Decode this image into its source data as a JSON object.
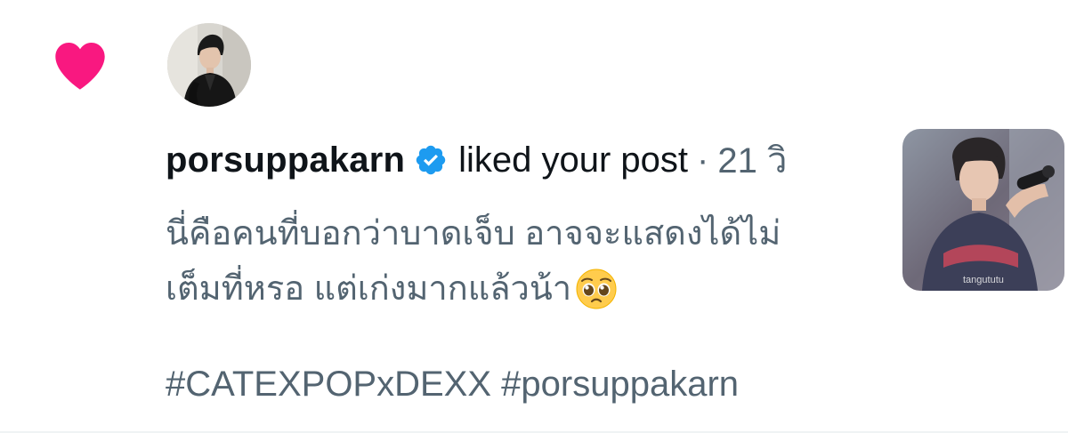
{
  "notification": {
    "type_icon": "heart-icon",
    "avatar": "user-avatar",
    "username": "porsuppakarn",
    "verified_icon": "verified-badge-icon",
    "action": "liked your post",
    "separator": "·",
    "time": "21 วิ",
    "post_text_line1": "นี่คือคนที่บอกว่าบาดเจ็บ อาจจะแสดงได้ไม่",
    "post_text_line2": "เต็มที่หรอ แต่เก่งมากแล้วน้า",
    "emoji": "pleading-face-emoji",
    "hashtags": "#CATEXPOPxDEXX #porsuppakarn",
    "thumbnail_caption": "tangututu"
  },
  "colors": {
    "heart": "#f91880",
    "verified": "#1d9bf0",
    "text_primary": "#0f1419",
    "text_secondary": "#536471"
  }
}
